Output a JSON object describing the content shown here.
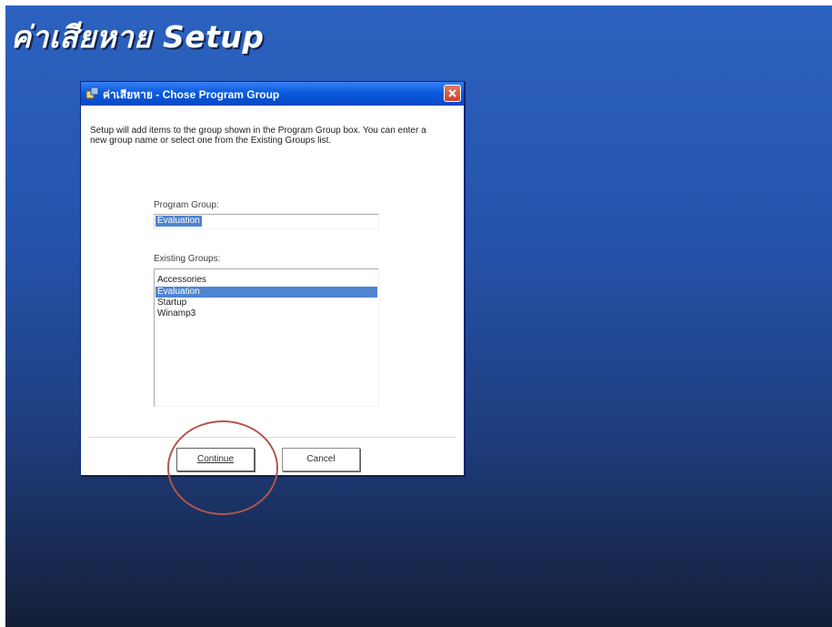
{
  "header": {
    "title": "ค่าเสียหาย Setup"
  },
  "dialog": {
    "title": "ค่าเสียหาย - Chose Program Group",
    "instructions": "Setup will add items to the group shown in the Program Group box. You can enter a new group name or select one from the Existing Groups list.",
    "program_group_label": "Program Group:",
    "program_group_value": "Evaluation",
    "existing_groups_label": "Existing Groups:",
    "existing_groups": [
      {
        "label": "Accessories",
        "selected": false
      },
      {
        "label": "Evaluation",
        "selected": true
      },
      {
        "label": "Startup",
        "selected": false
      },
      {
        "label": "Winamp3",
        "selected": false
      }
    ],
    "continue_label": "Continue",
    "cancel_label": "Cancel"
  },
  "icons": {
    "title_icon": "setup-icon",
    "close_icon": "close-icon"
  },
  "colors": {
    "desktop_top": "#2c62c0",
    "desktop_bottom": "#141f38",
    "titlebar": "#0a5bdf",
    "selection": "#4e84d0",
    "annotation_circle": "#b2554c"
  }
}
